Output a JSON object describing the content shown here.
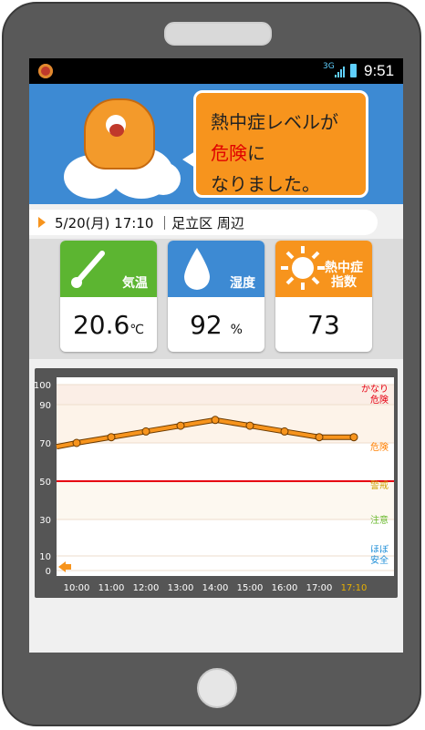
{
  "status_bar": {
    "network": "3G",
    "time": "9:51"
  },
  "banner": {
    "line1": "熱中症レベルが",
    "line2_highlight": "危険",
    "line2_rest": "に",
    "line3": "なりました。"
  },
  "datebar": {
    "text": "5/20(月) 17:10 ｜足立区 周辺"
  },
  "cards": [
    {
      "label": "気温",
      "value": "20.6",
      "unit": "℃",
      "color": "#5cb531",
      "icon": "thermometer-icon"
    },
    {
      "label": "湿度",
      "value": "92",
      "unit": "%",
      "color": "#3d8ad3",
      "icon": "water-drop-icon"
    },
    {
      "label": "熱中症\n指数",
      "value": "73",
      "unit": "",
      "color": "#f7941d",
      "icon": "sun-icon"
    }
  ],
  "chart_data": {
    "type": "line",
    "x": [
      "10:00",
      "11:00",
      "12:00",
      "13:00",
      "14:00",
      "15:00",
      "16:00",
      "17:00",
      "17:10"
    ],
    "series": [
      {
        "values": [
          70,
          73,
          76,
          79,
          82,
          79,
          76,
          73,
          73
        ]
      }
    ],
    "y_ticks": [
      0,
      10,
      30,
      50,
      70,
      90,
      100
    ],
    "ylim": [
      0,
      100
    ],
    "bands": [
      {
        "label": "かなり\n危険",
        "color": "#e60012"
      },
      {
        "label": "危険",
        "color": "#ff7f00"
      },
      {
        "label": "警戒",
        "color": "#d0a000"
      },
      {
        "label": "注意",
        "color": "#6dbb33"
      },
      {
        "label": "ほぼ\n安全",
        "color": "#1f8fd8"
      }
    ],
    "warning_line": 50,
    "line_color": "#f7941d"
  }
}
